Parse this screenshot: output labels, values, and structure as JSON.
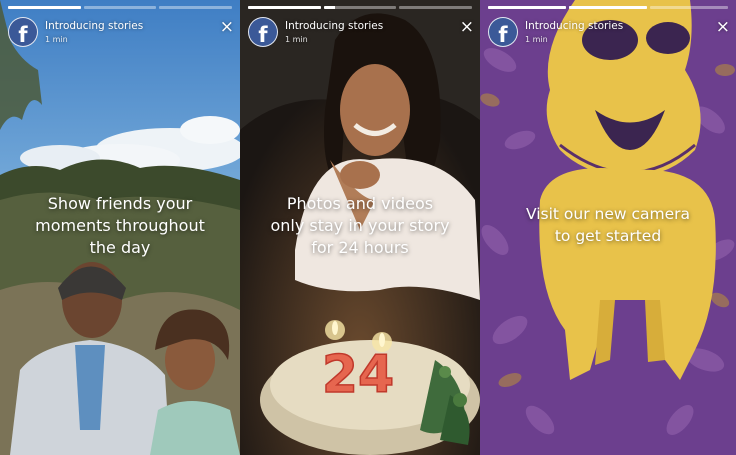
{
  "stories": [
    {
      "title": "Introducing stories",
      "time": "1 min",
      "caption_lines": [
        "Show friends your",
        "moments throughout",
        "the day"
      ],
      "progress": [
        1.0,
        0.0,
        0.0
      ]
    },
    {
      "title": "Introducing stories",
      "time": "1 min",
      "caption_lines": [
        "Photos and videos",
        "only stay in your story",
        "for 24 hours"
      ],
      "progress": [
        1.0,
        0.15,
        0.0
      ]
    },
    {
      "title": "Introducing stories",
      "time": "1 min",
      "caption_lines": [
        "Visit our new camera",
        "to get started"
      ],
      "progress": [
        1.0,
        1.0,
        0.0
      ]
    }
  ],
  "avatar_letter": "f",
  "close_symbol": "×",
  "cake_number": "24",
  "colors": {
    "facebook_blue": "#3b5998",
    "purple_tint": "#6c3f8e",
    "yellow_tint": "#e8c24a"
  },
  "icons": {
    "avatar": "facebook-logo-icon",
    "close": "close-icon"
  }
}
